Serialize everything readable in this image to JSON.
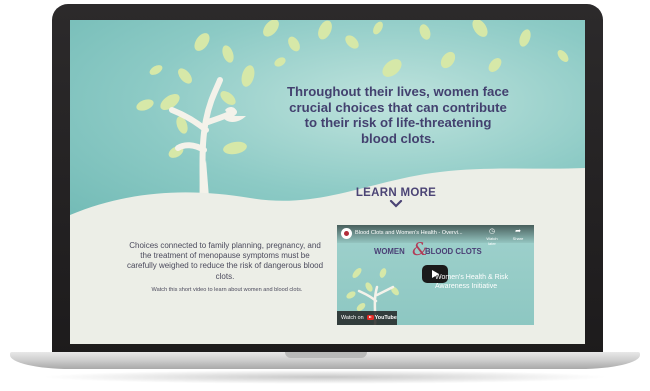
{
  "hero": {
    "headline": "Throughout their lives, women face crucial choices that can contribute to their risk of life-threatening blood clots.",
    "learn_more": "LEARN MORE",
    "colors": {
      "teal": "#8ccac5",
      "navy": "#43416f",
      "leaf": "#d6e8a8",
      "cream": "#eceee7"
    }
  },
  "content": {
    "body": "Choices connected to family planning, pregnancy, and the treatment of menopause symptoms must be carefully weighed to reduce the risk of dangerous blood clots.",
    "video_note": "Watch this short video to learn about women and blood clots."
  },
  "video": {
    "title": "Blood Clots and Women's Health - Overvi...",
    "controls": {
      "watch_later": "Watch later",
      "share": "Share"
    },
    "brand_women": "WOMEN",
    "brand_amp": "&",
    "brand_clots": "BLOOD CLOTS",
    "initiative": "Women's Health & Risk Awareness Initiative",
    "watch_on": "Watch on",
    "youtube": "YouTube"
  }
}
